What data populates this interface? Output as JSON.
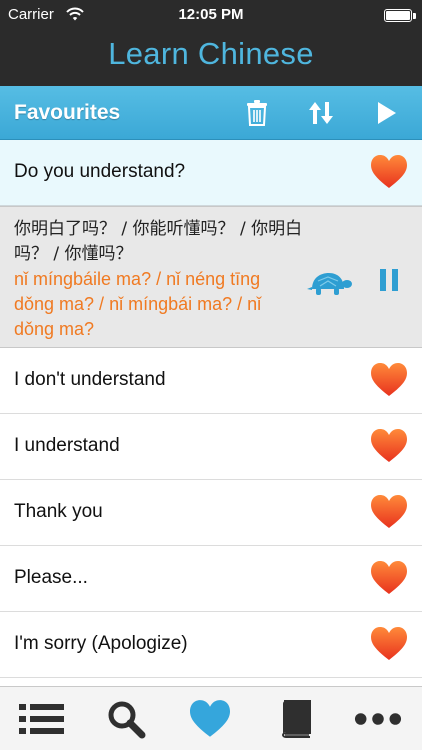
{
  "status_bar": {
    "carrier": "Carrier",
    "time": "12:05 PM",
    "battery_level": 1.0
  },
  "app": {
    "title": "Learn Chinese"
  },
  "toolbar": {
    "title": "Favourites",
    "icons": [
      "trash-icon",
      "sort-icon",
      "play-icon"
    ]
  },
  "list": {
    "selected": {
      "label": "Do you understand?"
    },
    "expanded": {
      "chinese": "你明白了吗？ / 你能听懂吗？ / 你明白吗？ / 你懂吗？",
      "pinyin": "nǐ míngbáile ma? / nǐ néng tīng dǒng ma? / nǐ míngbái ma? / nǐ dǒng ma?"
    },
    "items": [
      {
        "label": "I don't understand"
      },
      {
        "label": "I understand"
      },
      {
        "label": "Thank you"
      },
      {
        "label": "Please..."
      },
      {
        "label": "I'm sorry (Apologize)"
      }
    ]
  },
  "tab_bar": {
    "tabs": [
      "list-icon",
      "search-icon",
      "heart-icon",
      "book-icon",
      "more-icon"
    ],
    "active": "heart-icon"
  },
  "colors": {
    "header_bg": "#2b2b2b",
    "title_blue": "#4fb6de",
    "toolbar_blue": "#45b1dd",
    "pinyin_orange": "#f07a22",
    "heart_red": "#f05a28",
    "active_tab_blue": "#35a6dc"
  }
}
